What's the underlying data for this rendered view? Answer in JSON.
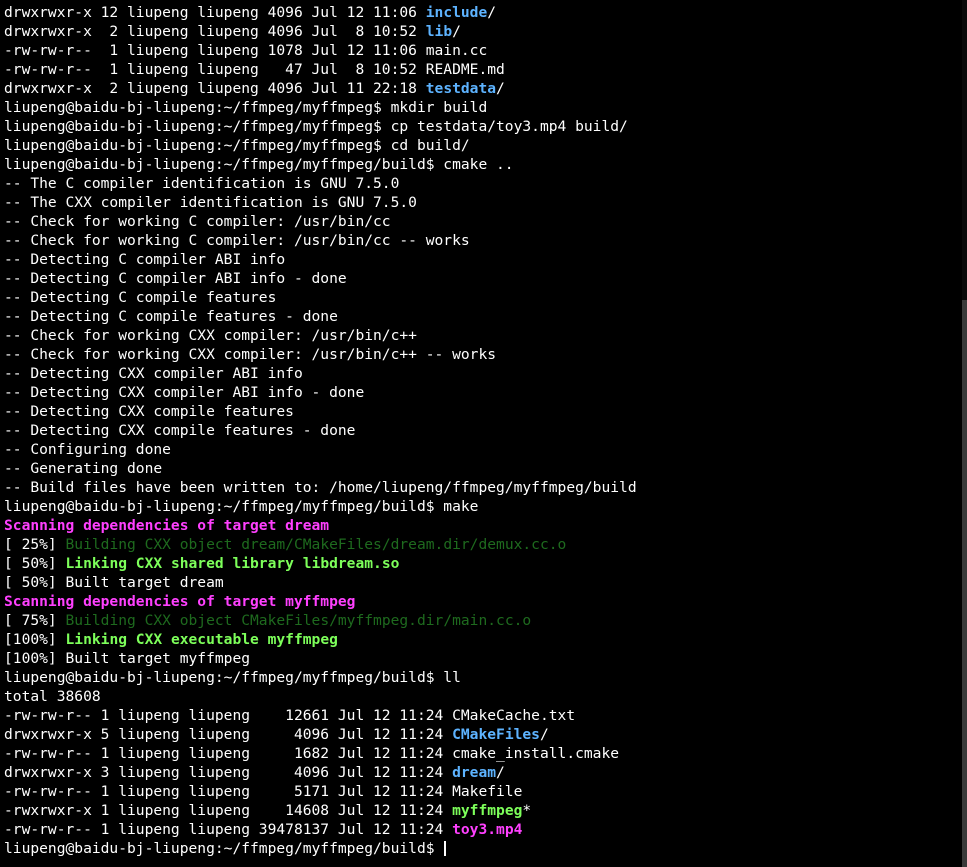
{
  "palette": {
    "fg": "#ffffff",
    "dir": "#5db3ff",
    "exe": "#7dff5a",
    "pink": "#ff40ff",
    "dim": "#1e6a1e",
    "green_bold": "#7dff5a",
    "cursor": "#ffffff"
  },
  "lines": [
    [
      {
        "t": "drwxrwxr-x 12 liupeng liupeng 4096 Jul 12 11:06 "
      },
      {
        "t": "include",
        "c": "dir",
        "b": true
      },
      {
        "t": "/"
      }
    ],
    [
      {
        "t": "drwxrwxr-x  2 liupeng liupeng 4096 Jul  8 10:52 "
      },
      {
        "t": "lib",
        "c": "dir",
        "b": true
      },
      {
        "t": "/"
      }
    ],
    [
      {
        "t": "-rw-rw-r--  1 liupeng liupeng 1078 Jul 12 11:06 main.cc"
      }
    ],
    [
      {
        "t": "-rw-rw-r--  1 liupeng liupeng   47 Jul  8 10:52 README.md"
      }
    ],
    [
      {
        "t": "drwxrwxr-x  2 liupeng liupeng 4096 Jul 11 22:18 "
      },
      {
        "t": "testdata",
        "c": "dir",
        "b": true
      },
      {
        "t": "/"
      }
    ],
    [
      {
        "t": "liupeng@baidu-bj-liupeng:~/ffmpeg/myffmpeg$ mkdir build"
      }
    ],
    [
      {
        "t": "liupeng@baidu-bj-liupeng:~/ffmpeg/myffmpeg$ cp testdata/toy3.mp4 build/"
      }
    ],
    [
      {
        "t": "liupeng@baidu-bj-liupeng:~/ffmpeg/myffmpeg$ cd build/"
      }
    ],
    [
      {
        "t": "liupeng@baidu-bj-liupeng:~/ffmpeg/myffmpeg/build$ cmake .."
      }
    ],
    [
      {
        "t": "-- The C compiler identification is GNU 7.5.0"
      }
    ],
    [
      {
        "t": "-- The CXX compiler identification is GNU 7.5.0"
      }
    ],
    [
      {
        "t": "-- Check for working C compiler: /usr/bin/cc"
      }
    ],
    [
      {
        "t": "-- Check for working C compiler: /usr/bin/cc -- works"
      }
    ],
    [
      {
        "t": "-- Detecting C compiler ABI info"
      }
    ],
    [
      {
        "t": "-- Detecting C compiler ABI info - done"
      }
    ],
    [
      {
        "t": "-- Detecting C compile features"
      }
    ],
    [
      {
        "t": "-- Detecting C compile features - done"
      }
    ],
    [
      {
        "t": "-- Check for working CXX compiler: /usr/bin/c++"
      }
    ],
    [
      {
        "t": "-- Check for working CXX compiler: /usr/bin/c++ -- works"
      }
    ],
    [
      {
        "t": "-- Detecting CXX compiler ABI info"
      }
    ],
    [
      {
        "t": "-- Detecting CXX compiler ABI info - done"
      }
    ],
    [
      {
        "t": "-- Detecting CXX compile features"
      }
    ],
    [
      {
        "t": "-- Detecting CXX compile features - done"
      }
    ],
    [
      {
        "t": "-- Configuring done"
      }
    ],
    [
      {
        "t": "-- Generating done"
      }
    ],
    [
      {
        "t": "-- Build files have been written to: /home/liupeng/ffmpeg/myffmpeg/build"
      }
    ],
    [
      {
        "t": "liupeng@baidu-bj-liupeng:~/ffmpeg/myffmpeg/build$ make"
      }
    ],
    [
      {
        "t": "Scanning dependencies of target dream",
        "c": "pink",
        "b": true
      }
    ],
    [
      {
        "t": "[ 25%] "
      },
      {
        "t": "Building CXX object dream/CMakeFiles/dream.dir/demux.cc.o",
        "c": "dim"
      }
    ],
    [
      {
        "t": "[ 50%] "
      },
      {
        "t": "Linking CXX shared library libdream.so",
        "c": "green_bold",
        "b": true
      }
    ],
    [
      {
        "t": "[ 50%] Built target dream"
      }
    ],
    [
      {
        "t": "Scanning dependencies of target myffmpeg",
        "c": "pink",
        "b": true
      }
    ],
    [
      {
        "t": "[ 75%] "
      },
      {
        "t": "Building CXX object CMakeFiles/myffmpeg.dir/main.cc.o",
        "c": "dim"
      }
    ],
    [
      {
        "t": "[100%] "
      },
      {
        "t": "Linking CXX executable myffmpeg",
        "c": "green_bold",
        "b": true
      }
    ],
    [
      {
        "t": "[100%] Built target myffmpeg"
      }
    ],
    [
      {
        "t": "liupeng@baidu-bj-liupeng:~/ffmpeg/myffmpeg/build$ ll"
      }
    ],
    [
      {
        "t": "total 38608"
      }
    ],
    [
      {
        "t": "-rw-rw-r-- 1 liupeng liupeng    12661 Jul 12 11:24 CMakeCache.txt"
      }
    ],
    [
      {
        "t": "drwxrwxr-x 5 liupeng liupeng     4096 Jul 12 11:24 "
      },
      {
        "t": "CMakeFiles",
        "c": "dir",
        "b": true
      },
      {
        "t": "/"
      }
    ],
    [
      {
        "t": "-rw-rw-r-- 1 liupeng liupeng     1682 Jul 12 11:24 cmake_install.cmake"
      }
    ],
    [
      {
        "t": "drwxrwxr-x 3 liupeng liupeng     4096 Jul 12 11:24 "
      },
      {
        "t": "dream",
        "c": "dir",
        "b": true
      },
      {
        "t": "/"
      }
    ],
    [
      {
        "t": "-rw-rw-r-- 1 liupeng liupeng     5171 Jul 12 11:24 Makefile"
      }
    ],
    [
      {
        "t": "-rwxrwxr-x 1 liupeng liupeng    14608 Jul 12 11:24 "
      },
      {
        "t": "myffmpeg",
        "c": "exe",
        "b": true
      },
      {
        "t": "*"
      }
    ],
    [
      {
        "t": "-rw-rw-r-- 1 liupeng liupeng 39478137 Jul 12 11:24 "
      },
      {
        "t": "toy3.mp4",
        "c": "pink",
        "b": true
      }
    ],
    [
      {
        "t": "liupeng@baidu-bj-liupeng:~/ffmpeg/myffmpeg/build$ "
      }
    ]
  ]
}
